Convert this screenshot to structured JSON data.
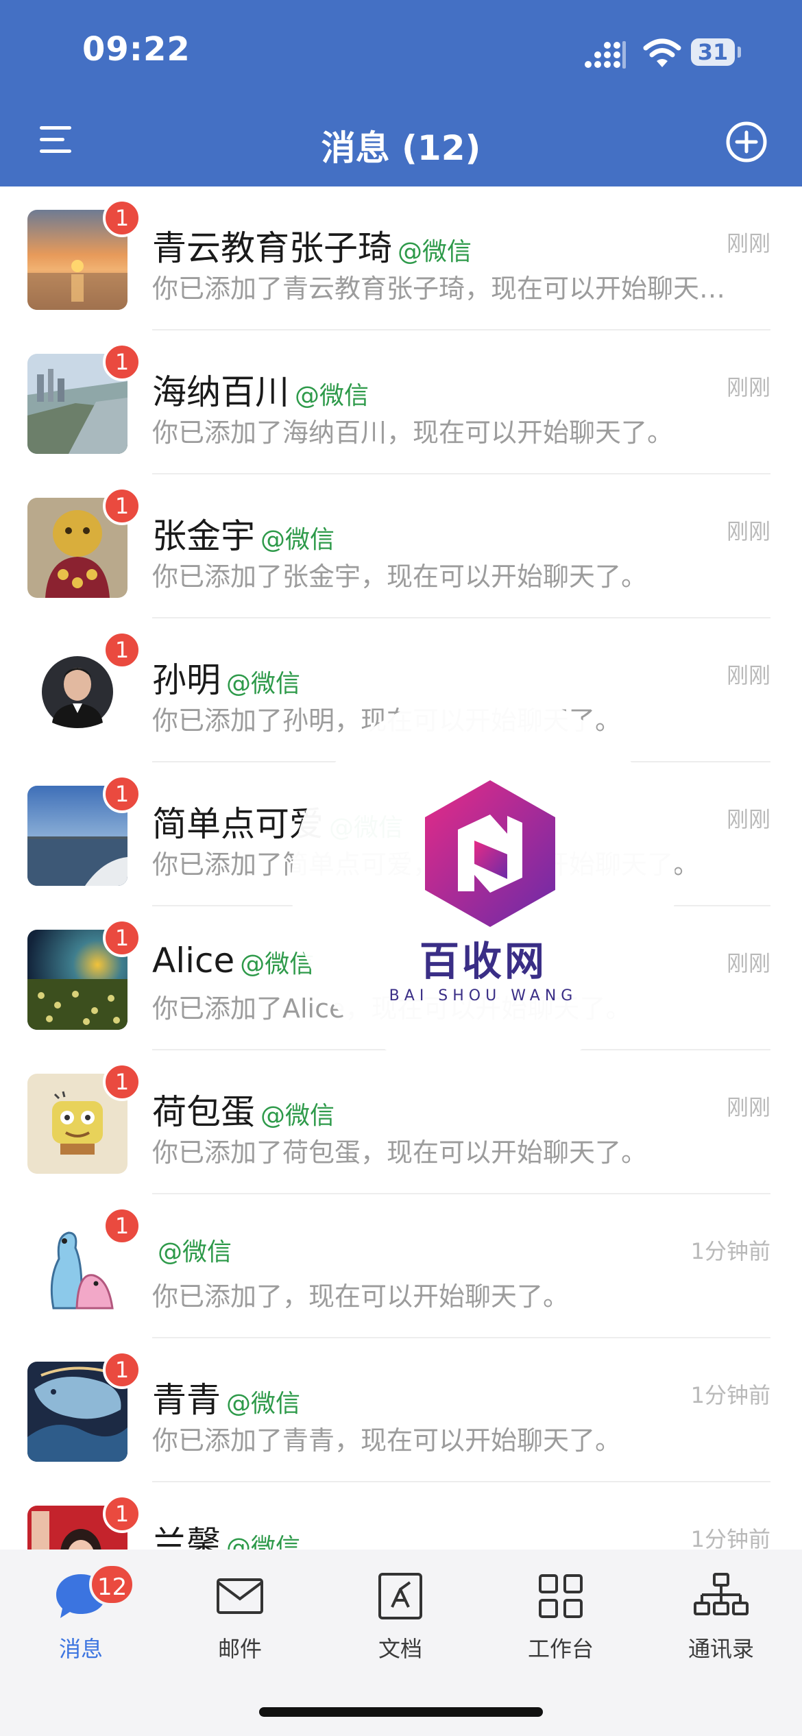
{
  "status_bar": {
    "time": "09:22",
    "battery": "31"
  },
  "nav": {
    "title": "消息 (12)"
  },
  "source_tag": "@微信",
  "conversations": [
    {
      "name": "青云教育张子琦",
      "preview": "你已添加了青云教育张子琦，现在可以开始聊天了。",
      "time": "刚刚",
      "unread": "1"
    },
    {
      "name": "海纳百川",
      "preview": "你已添加了海纳百川，现在可以开始聊天了。",
      "time": "刚刚",
      "unread": "1"
    },
    {
      "name": "张金宇",
      "preview": "你已添加了张金宇，现在可以开始聊天了。",
      "time": "刚刚",
      "unread": "1"
    },
    {
      "name": "孙明",
      "preview": "你已添加了孙明，现在可以开始聊天了。",
      "time": "刚刚",
      "unread": "1"
    },
    {
      "name": "简单点可爱",
      "preview": "你已添加了简单点可爱，现在可以开始聊天了。",
      "time": "刚刚",
      "unread": "1"
    },
    {
      "name": "Alice",
      "preview": "你已添加了Alice，现在可以开始聊天了。",
      "time": "刚刚",
      "unread": "1"
    },
    {
      "name": "荷包蛋",
      "preview": "你已添加了荷包蛋，现在可以开始聊天了。",
      "time": "刚刚",
      "unread": "1"
    },
    {
      "name": "",
      "preview": "你已添加了，现在可以开始聊天了。",
      "time": "1分钟前",
      "unread": "1"
    },
    {
      "name": "青青",
      "preview": "你已添加了青青，现在可以开始聊天了。",
      "time": "1分钟前",
      "unread": "1"
    },
    {
      "name": "兰馨",
      "preview": "",
      "time": "1分钟前",
      "unread": "1"
    }
  ],
  "watermark": {
    "title": "百收网",
    "subtitle": "BAI SHOU WANG"
  },
  "tabs": [
    {
      "label": "消息",
      "badge": "12"
    },
    {
      "label": "邮件"
    },
    {
      "label": "文档"
    },
    {
      "label": "工作台"
    },
    {
      "label": "通讯录"
    }
  ],
  "colors": {
    "header": "#4470C4",
    "badge": "#EA4A3F",
    "source_tag": "#2E9A4A",
    "active_tab": "#3B74E0"
  }
}
